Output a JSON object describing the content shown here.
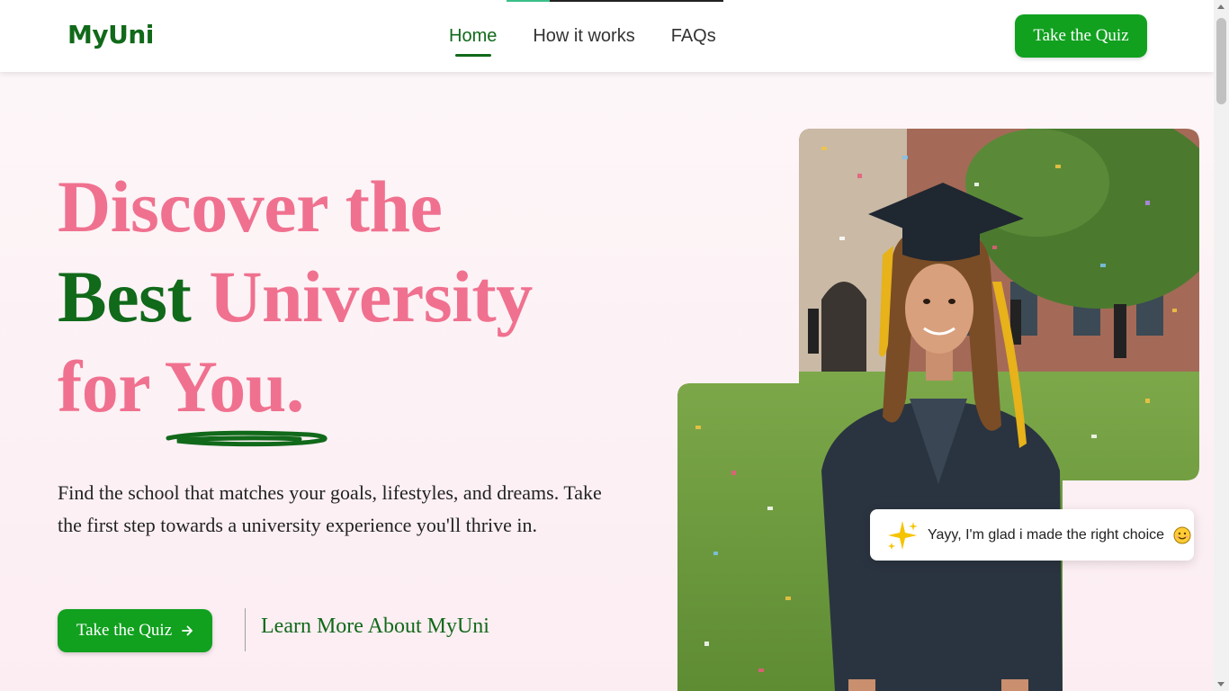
{
  "header": {
    "logo": "MyUni",
    "nav": [
      {
        "label": "Home",
        "active": true
      },
      {
        "label": "How it works",
        "active": false
      },
      {
        "label": "FAQs",
        "active": false
      }
    ],
    "cta_label": "Take the Quiz",
    "reading_progress": 0.2
  },
  "hero": {
    "headline": {
      "line1": "Discover the",
      "line2_green": "Best",
      "line2_pink": "University",
      "line3": "for You."
    },
    "description": "Find the school that matches your goals, lifestyles, and dreams. Take the first step towards a university experience you'll thrive in.",
    "primary_button": "Take the Quiz",
    "secondary_link": "Learn More About MyUni",
    "toast": {
      "icon": "sparkles-icon",
      "text": "Yayy, I'm glad i made the right choice",
      "emoji": "smiley-icon"
    }
  },
  "colors": {
    "brand_green": "#11691a",
    "button_green": "#11a11f",
    "headline_pink": "#f0718f",
    "hero_bg": "#fdf6f8"
  },
  "icons": {
    "arrow": "arrow-right-icon",
    "sparkle": "sparkles-icon"
  }
}
